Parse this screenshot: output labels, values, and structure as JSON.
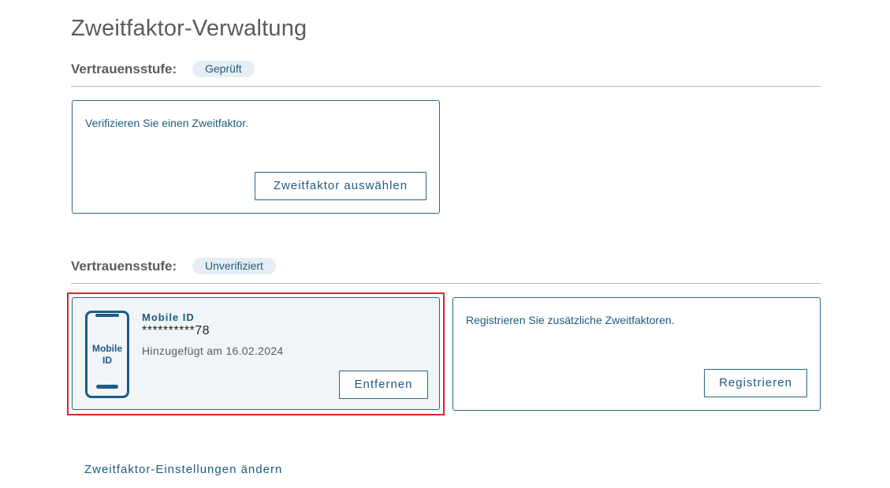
{
  "page": {
    "title": "Zweitfaktor-Verwaltung"
  },
  "sections": [
    {
      "label": "Vertrauensstufe:",
      "badge": "Geprüft",
      "card": {
        "message": "Verifizieren Sie einen Zweitfaktor.",
        "button": "Zweitfaktor auswählen"
      }
    },
    {
      "label": "Vertrauensstufe:",
      "badge": "Unverifiziert",
      "device": {
        "icon": "mobile-phone-icon",
        "icon_text": [
          "Mobile",
          "ID"
        ],
        "title": "Mobile ID",
        "number": "**********78",
        "added": "Hinzugefügt am 16.02.2024",
        "button": "Entfernen"
      },
      "register": {
        "message": "Registrieren Sie zusätzliche Zweitfaktoren.",
        "button": "Registrieren"
      }
    }
  ],
  "footer_link": "Zweitfaktor-Einstellungen ändern",
  "colors": {
    "accent": "#1f5a80",
    "highlight": "#d8242f",
    "badge_bg": "#e6eef3",
    "device_card_bg": "#f0f5f8"
  }
}
